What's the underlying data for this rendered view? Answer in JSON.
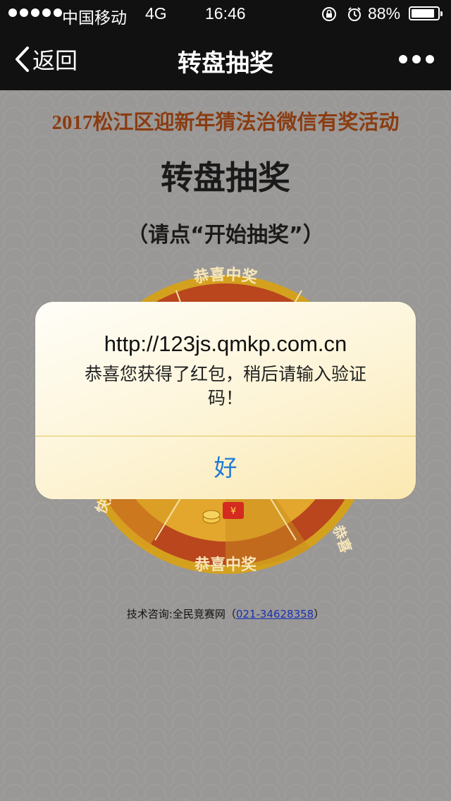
{
  "status_bar": {
    "carrier": "中国移动",
    "network": "4G",
    "time": "16:46",
    "battery": "88%",
    "battery_level": 0.88,
    "icons": [
      "signal-dots-icon",
      "rotation-lock-icon",
      "alarm-icon",
      "battery-icon"
    ]
  },
  "nav": {
    "back_label": "返回",
    "title": "转盘抽奖",
    "back_icon": "chevron-left-icon",
    "more_icon": "ellipsis-icon"
  },
  "page": {
    "event_title": "2017松江区迎新年猜法治微信有奖活动",
    "main_title": "转盘抽奖",
    "hint": "（请点“开始抽奖”）",
    "wheel": {
      "top_label": "恭喜中奖",
      "bottom_label": "恭喜中奖",
      "left_label": "快乐",
      "right_label": "恭喜",
      "prize_icon": "red-envelope-coins-icon"
    },
    "tech_prefix": "技术咨询:全民竞赛网（",
    "tech_link": "021-34628358",
    "tech_suffix": "）"
  },
  "colors": {
    "wheel_gold": "#d6a52a",
    "wheel_red": "#b7451e",
    "event_title": "#8a3c12",
    "link_blue": "#1f7ad6"
  },
  "dialog": {
    "title": "http://123js.qmkp.com.cn",
    "message": "恭喜您获得了红包，稍后请输入验证码！",
    "ok_label": "好"
  }
}
